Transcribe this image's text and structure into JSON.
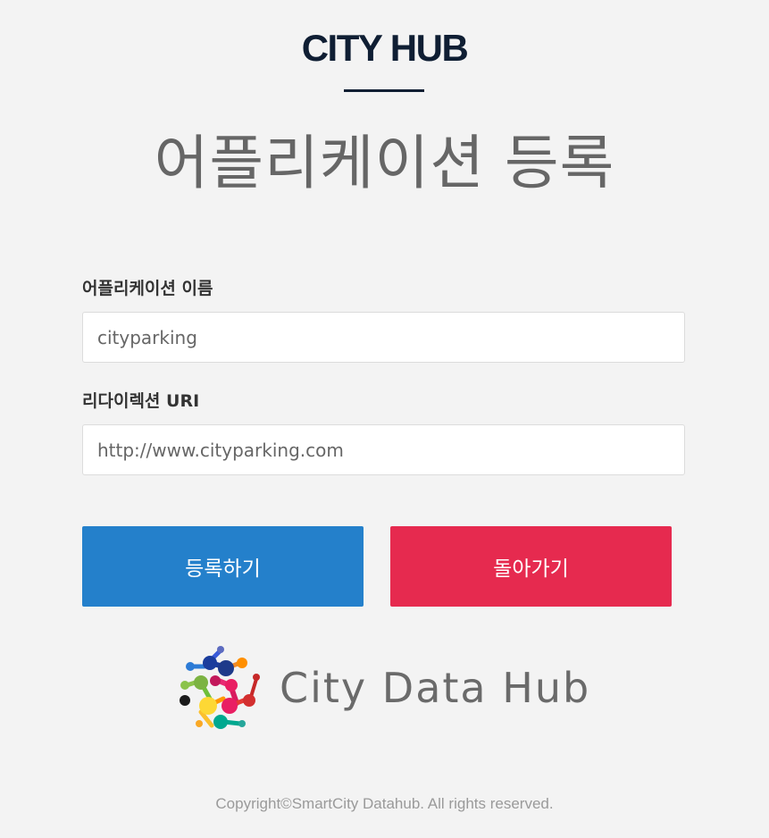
{
  "header": {
    "brand": "CITY HUB",
    "title": "어플리케이션 등록"
  },
  "form": {
    "app_name": {
      "label": "어플리케이션 이름",
      "value": "cityparking"
    },
    "redirect_uri": {
      "label": "리다이렉션 URI",
      "value": "http://www.cityparking.com"
    }
  },
  "actions": {
    "register_label": "등록하기",
    "back_label": "돌아가기"
  },
  "logo": {
    "text": "City Data Hub"
  },
  "footer": {
    "copyright": "Copyright©SmartCity Datahub. All rights reserved."
  },
  "colors": {
    "brand_navy": "#0f1e33",
    "register_blue": "#2480cb",
    "back_red": "#e62a4f",
    "background": "#f3f3f3"
  }
}
